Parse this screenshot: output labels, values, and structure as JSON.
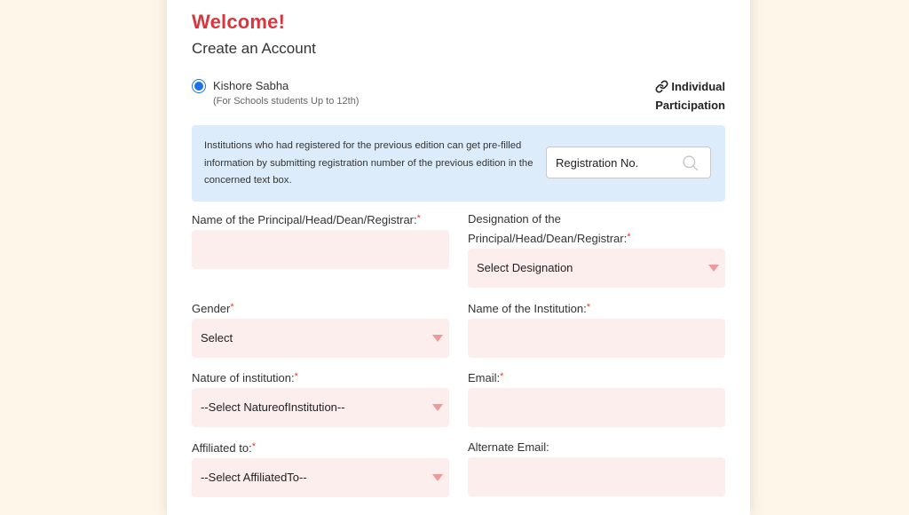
{
  "header": {
    "welcome": "Welcome!",
    "subtitle": "Create an Account"
  },
  "participation": {
    "option_label": "Kishore Sabha",
    "option_sub": "(For Schools students Up to 12th)",
    "option_selected": true,
    "individual_line1": "Individual",
    "individual_line2": "Participation",
    "individual_icon": "link-icon"
  },
  "info": {
    "text": "Institutions who had registered for the previous edition can get pre-filled information by submitting registration number of the previous edition in the concerned text box.",
    "reg_placeholder": "Registration No.",
    "reg_value": "",
    "search_icon": "search-icon"
  },
  "colors": {
    "accent_red": "#d9363e",
    "radio_blue": "#1a73e8",
    "info_bg": "#dcecfa",
    "field_bg": "#fdeeee",
    "page_bg": "#fef7e9"
  },
  "form": {
    "principal_name": {
      "label": "Name of the Principal/Head/Dean/Registrar:",
      "required": "*",
      "value": ""
    },
    "designation": {
      "label_line1": "Designation of the",
      "label_line2": "Principal/Head/Dean/Registrar:",
      "required": "*",
      "selected": "Select Designation"
    },
    "gender": {
      "label": "Gender",
      "required": "*",
      "selected": "Select"
    },
    "institution_name": {
      "label": "Name of the Institution:",
      "required": "*",
      "value": ""
    },
    "nature": {
      "label": "Nature of institution:",
      "required": "*",
      "selected": "--Select NatureofInstitution--"
    },
    "email": {
      "label": "Email:",
      "required": "*",
      "value": ""
    },
    "affiliated": {
      "label": "Affiliated to:",
      "required": "*",
      "selected": "--Select AffiliatedTo--"
    },
    "alt_email": {
      "label": "Alternate Email:",
      "value": ""
    }
  }
}
